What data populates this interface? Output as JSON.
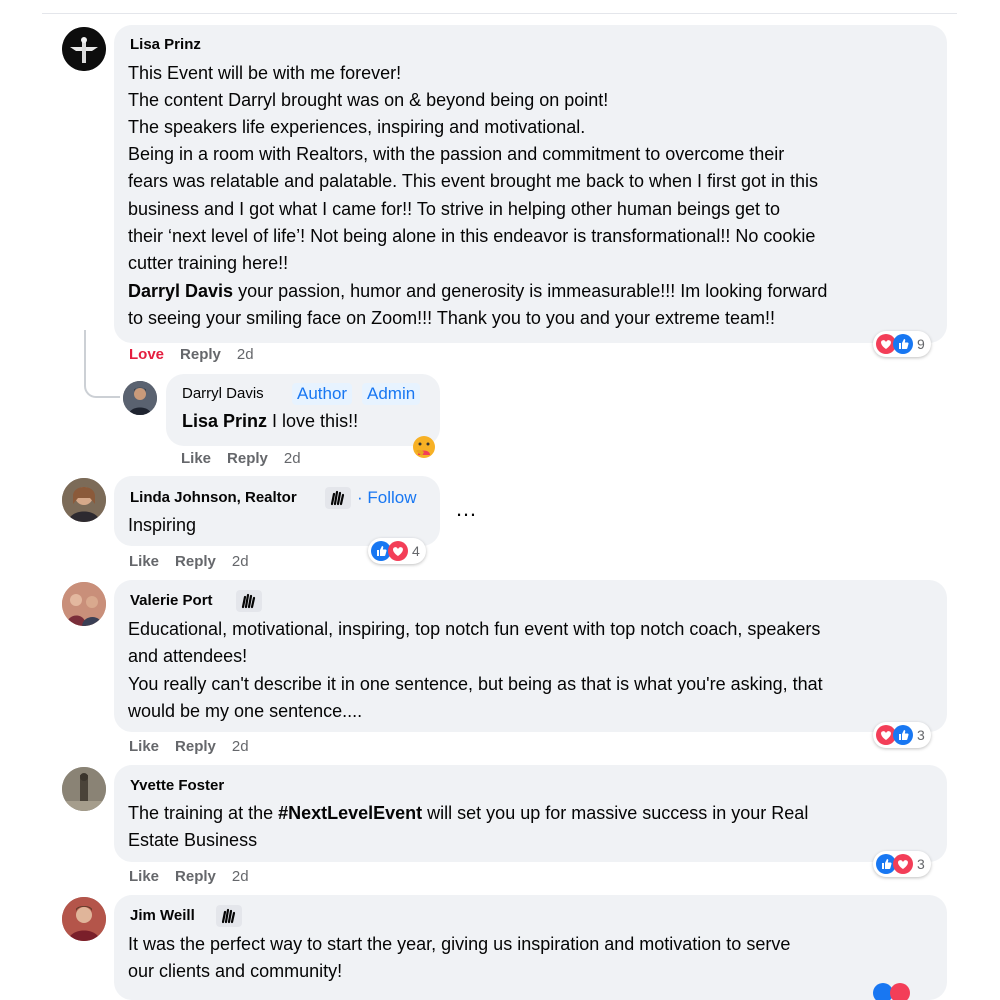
{
  "comments": [
    {
      "author": "Lisa Prinz",
      "lines": [
        "This Event will be with me forever!",
        "The content Darryl brought was on & beyond being on point!",
        "The speakers life experiences, inspiring and motivational.",
        "Being in a room with Realtors, with the passion and commitment to overcome their",
        "fears was relatable and palatable. This event brought me back to when I first got in this",
        "business and I got what I came for!! To strive in helping other human beings get to",
        "their ‘next level of life’! Not being alone in this endeavor is transformational!! No cookie",
        "cutter training here!!"
      ],
      "mention": "Darryl Davis",
      "last_line_a": " your passion, humor and generosity is immeasurable!!! Im looking forward",
      "last_line_b": "to seeing your smiling face on Zoom!!! Thank you to you and your extreme team!!",
      "action_react": "Love",
      "action_reply": "Reply",
      "time": "2d",
      "reaction_count": "9"
    },
    {
      "author": "Darryl Davis",
      "badge_author": "Author",
      "badge_admin": "Admin",
      "mention": "Lisa Prinz",
      "text": " I love this!!",
      "action_react": "Like",
      "action_reply": "Reply",
      "time": "2d"
    },
    {
      "author": "Linda Johnson, Realtor",
      "follow": "· Follow",
      "text": "Inspiring",
      "more": "…",
      "action_react": "Like",
      "action_reply": "Reply",
      "time": "2d",
      "reaction_count": "4"
    },
    {
      "author": "Valerie Port",
      "lines": [
        "Educational, motivational, inspiring, top notch fun event with top notch coach, speakers",
        "and attendees!",
        "You really can't describe it in one sentence, but being as that is what you're asking, that",
        "would be my one sentence...."
      ],
      "action_react": "Like",
      "action_reply": "Reply",
      "time": "2d",
      "reaction_count": "3"
    },
    {
      "author": "Yvette Foster",
      "text_a": "The training at the ",
      "hashtag": "#NextLevelEvent",
      "text_b": " will set you up for massive success in your Real",
      "line2": "Estate Business",
      "action_react": "Like",
      "action_reply": "Reply",
      "time": "2d",
      "reaction_count": "3"
    },
    {
      "author": "Jim Weill",
      "lines": [
        "It was the perfect way to start the year, giving us inspiration and motivation to serve",
        "our clients and community!"
      ]
    }
  ],
  "colors": {
    "like": "#1877f2",
    "love": "#f33e58",
    "bubble": "#f0f2f5",
    "link": "#1877f2",
    "meta": "#65676b"
  },
  "icons": [
    "like-reaction-icon",
    "love-reaction-icon",
    "care-reaction-icon",
    "top-fan-icon",
    "more-options-icon"
  ]
}
